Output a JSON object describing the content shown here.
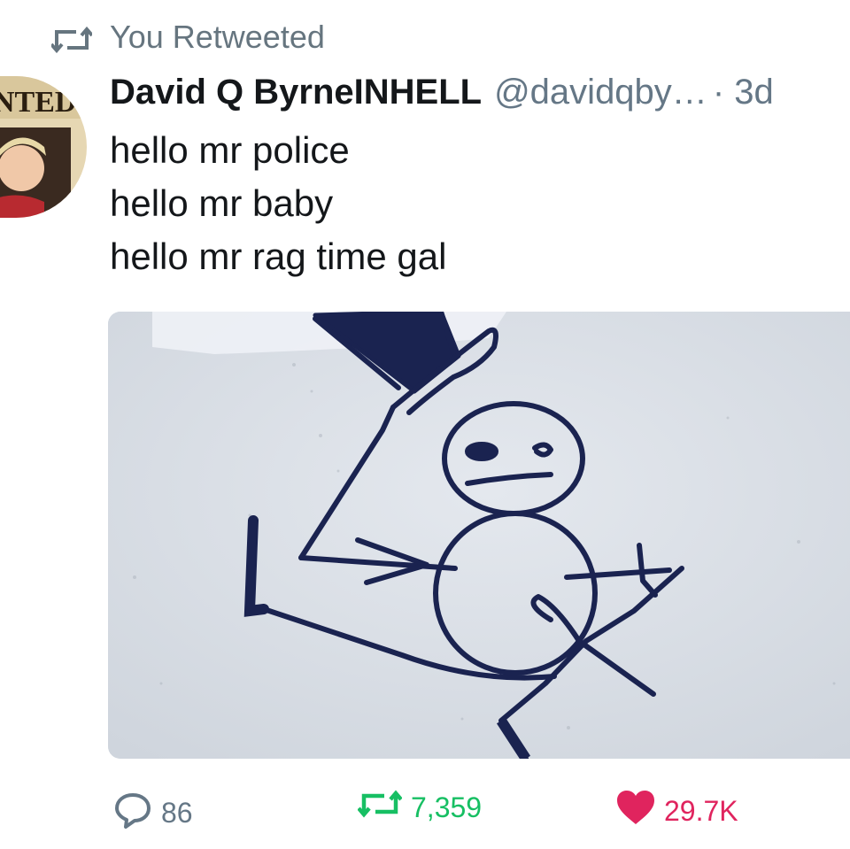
{
  "retweet_context": {
    "icon": "retweet-icon",
    "label": "You Retweeted"
  },
  "tweet": {
    "avatar": "avatar",
    "display_name": "David Q ByrneINHELL",
    "handle": "@davidqby…",
    "timestamp": "· 3d",
    "text_lines": [
      "hello mr police",
      "hello mr baby",
      "hello mr rag time gal"
    ],
    "media": "stick-figure-drawing-image"
  },
  "actions": {
    "reply": {
      "icon": "reply-icon",
      "count": "86"
    },
    "retweet": {
      "icon": "retweet-icon",
      "count": "7,359"
    },
    "like": {
      "icon": "heart-icon",
      "count": "29.7K"
    }
  },
  "colors": {
    "secondary_text": "#657786",
    "retweet_active": "#17bf63",
    "like_active": "#e0245e",
    "ink": "#1a2350"
  }
}
